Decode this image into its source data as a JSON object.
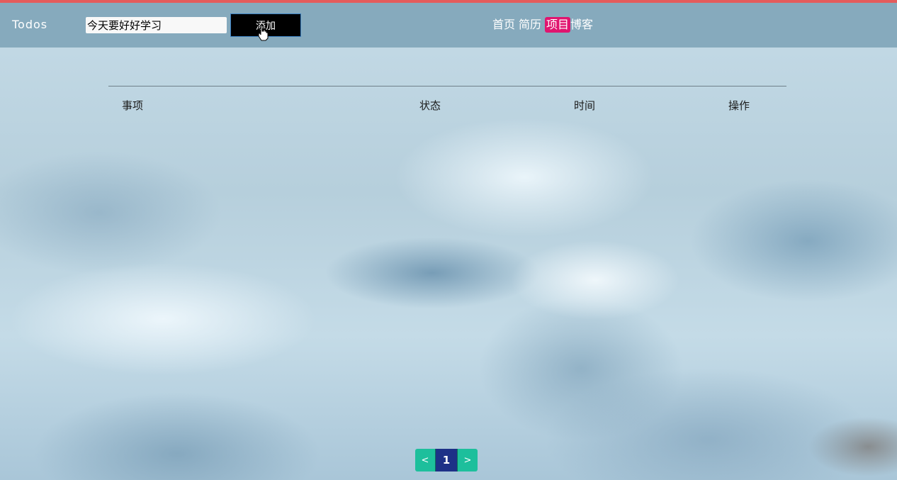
{
  "app": {
    "brand": "Todos"
  },
  "toolbar": {
    "input_value": "今天要好好学习",
    "add_label": "添加"
  },
  "nav": {
    "items": [
      {
        "label": "首页",
        "active": false
      },
      {
        "label": "简历",
        "active": false
      },
      {
        "label": "项目",
        "active": true
      },
      {
        "label": "博客",
        "active": false
      }
    ]
  },
  "table": {
    "headers": [
      "事项",
      "状态",
      "时间",
      "操作"
    ],
    "rows": []
  },
  "pagination": {
    "prev": "<",
    "current": "1",
    "next": ">"
  },
  "colors": {
    "accent_top": "#e45c5c",
    "navbar": "#86aabd",
    "nav_active": "#e0156f",
    "pager": "#1dbf9c",
    "pager_current": "#1d3187"
  }
}
